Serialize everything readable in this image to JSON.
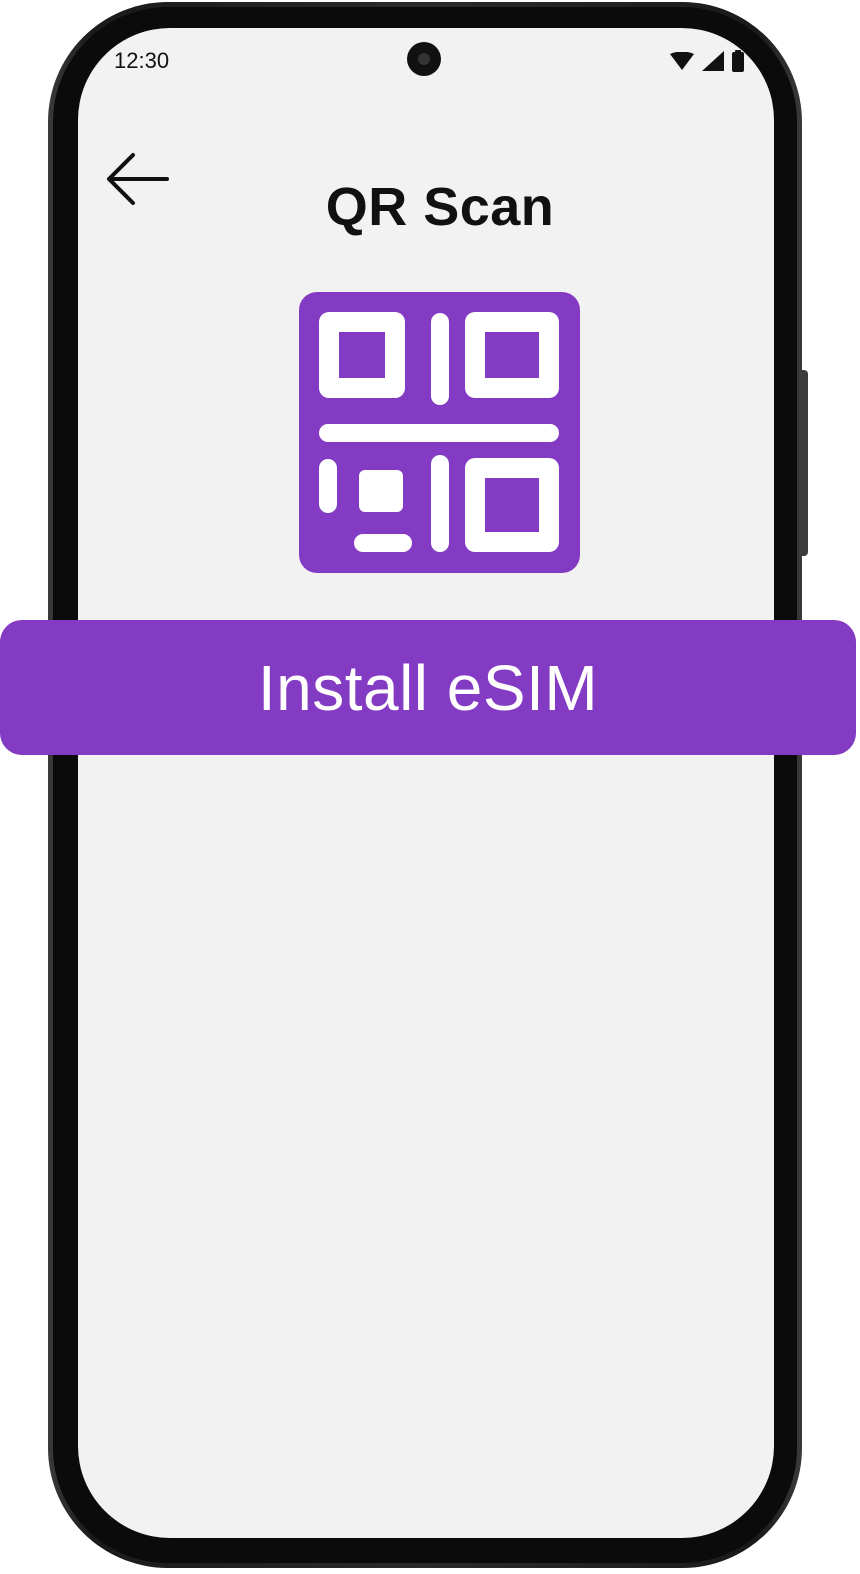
{
  "status_bar": {
    "time": "12:30",
    "icons": [
      "wifi-icon",
      "cellular-signal-icon",
      "battery-icon"
    ]
  },
  "header": {
    "back_icon": "arrow-left-icon",
    "title": "QR Scan"
  },
  "hero": {
    "icon": "qr-code-icon"
  },
  "actions": {
    "install_label": "Install eSIM"
  },
  "colors": {
    "accent": "#833BC4",
    "screen_background": "#F2F2F2",
    "text": "#111111"
  }
}
